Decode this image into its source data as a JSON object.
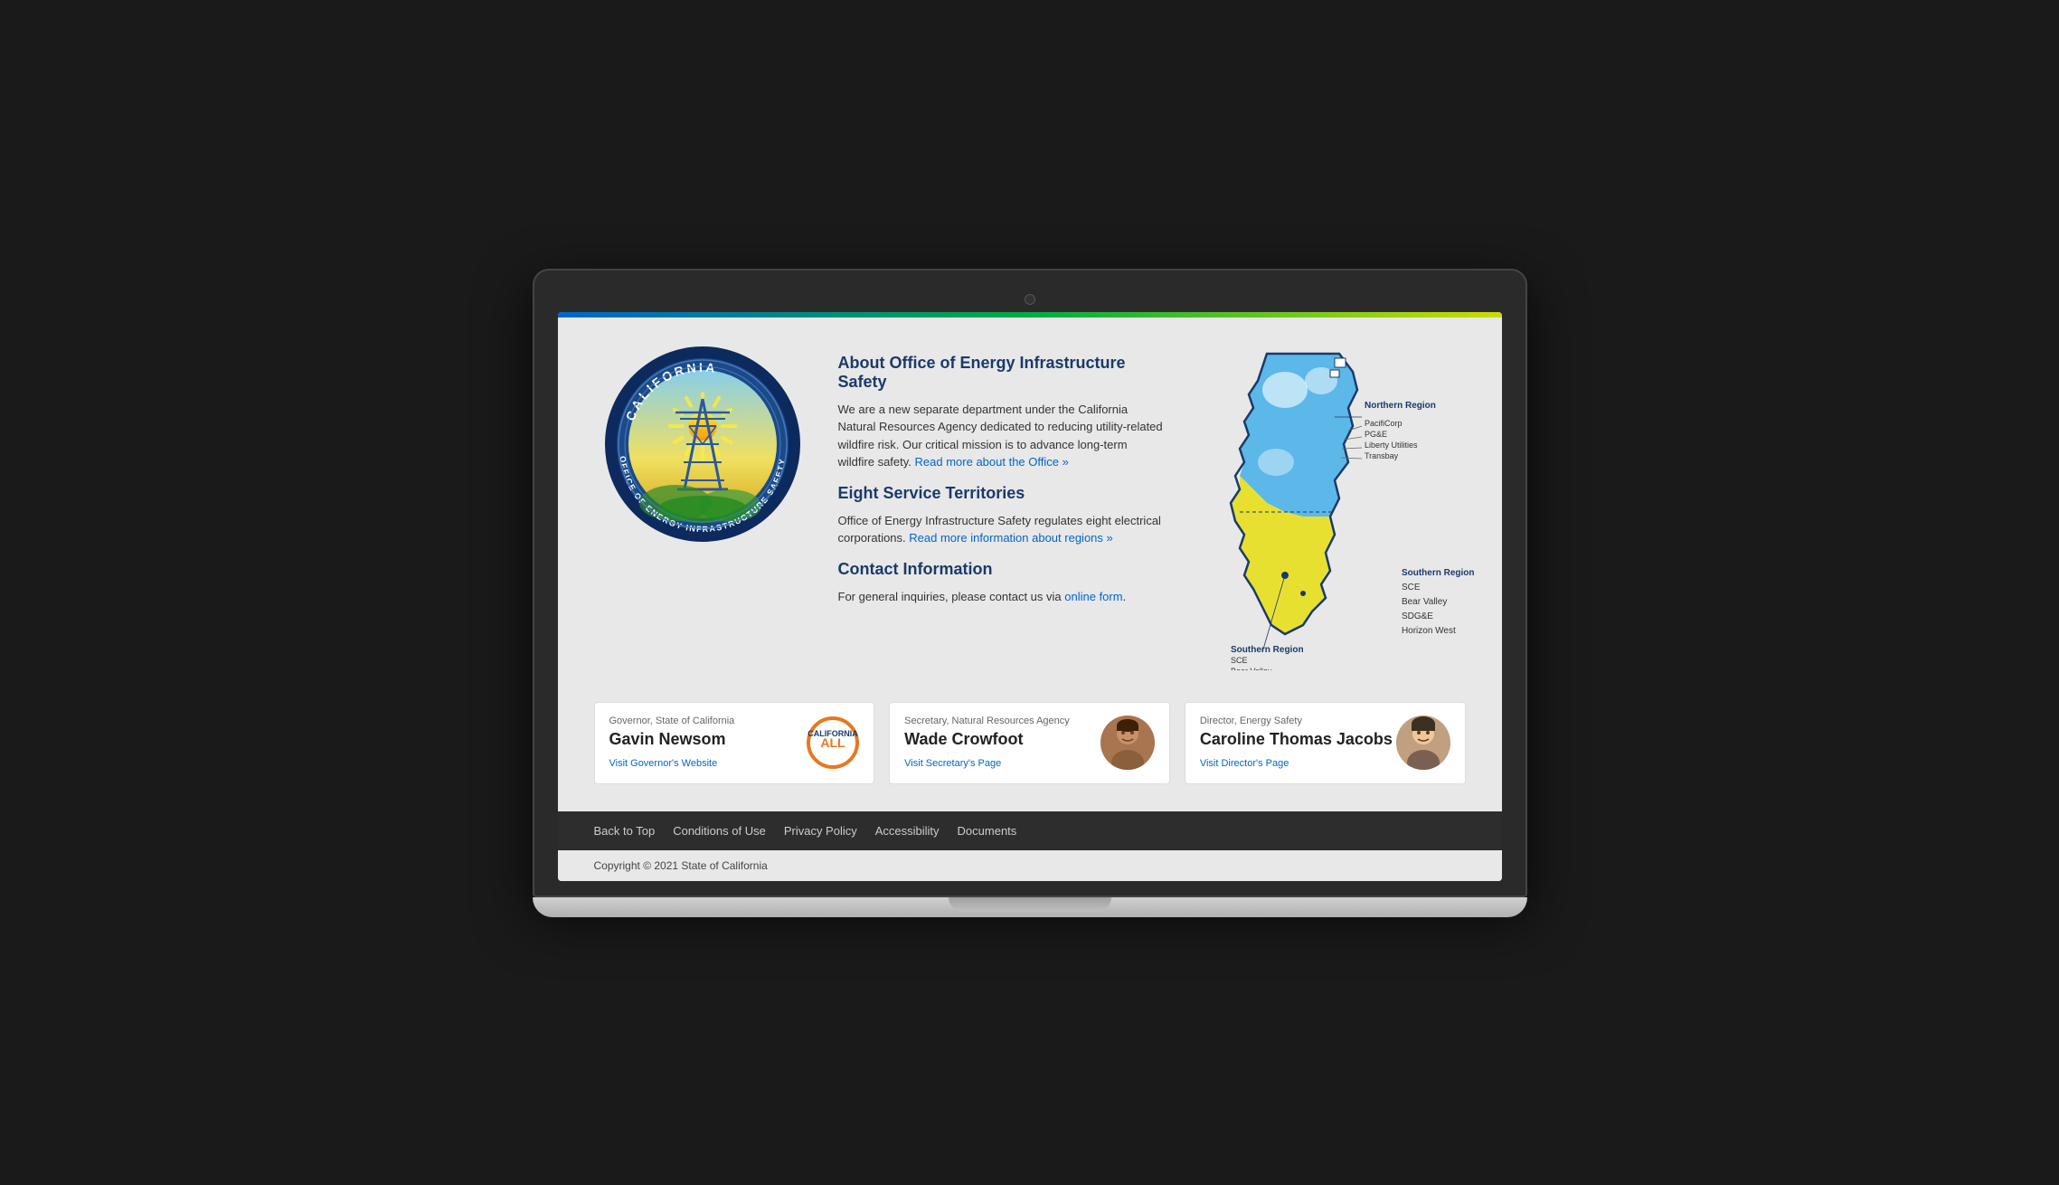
{
  "page": {
    "gradient_bar": true,
    "accent_colors": {
      "blue": "#0066cc",
      "green": "#00aa44",
      "yellow_green": "#ccdd00",
      "dark_blue": "#1a3a6b"
    }
  },
  "about": {
    "title": "About Office of Energy Infrastructure Safety",
    "description": "We are a new separate department under the California Natural Resources Agency dedicated to reducing utility-related wildfire risk. Our critical mission is to advance long-term wildfire safety.",
    "read_more_link": "Read more about the Office »"
  },
  "territories": {
    "title": "Eight Service Territories",
    "description": "Office of Energy Infrastructure Safety regulates eight electrical corporations.",
    "read_more_link": "Read more information about regions »"
  },
  "contact": {
    "title": "Contact Information",
    "description": "For general inquiries, please contact us via",
    "link_text": "online form",
    "period": "."
  },
  "map": {
    "northern_region_label": "Northern Region",
    "northern_utilities": [
      "PacifiCorp",
      "PG&E",
      "Liberty Utilities",
      "Transbay"
    ],
    "southern_region_label": "Southern Region",
    "southern_utilities": [
      "SCE",
      "Bear Valley",
      "SDG&E",
      "Horizon West"
    ]
  },
  "people": [
    {
      "role": "Governor, State of California",
      "name": "Gavin Newsom",
      "link_text": "Visit Governor's Website",
      "has_logo": true
    },
    {
      "role": "Secretary, Natural Resources Agency",
      "name": "Wade Crowfoot",
      "link_text": "Visit Secretary's Page",
      "has_photo": true,
      "photo_bg": "#a87550"
    },
    {
      "role": "Director, Energy Safety",
      "name": "Caroline Thomas Jacobs",
      "link_text": "Visit Director's Page",
      "has_photo": true,
      "photo_bg": "#c0a080"
    }
  ],
  "footer": {
    "links": [
      "Back to Top",
      "Conditions of Use",
      "Privacy Policy",
      "Accessibility",
      "Documents"
    ],
    "copyright": "Copyright © 2021 State of California"
  }
}
